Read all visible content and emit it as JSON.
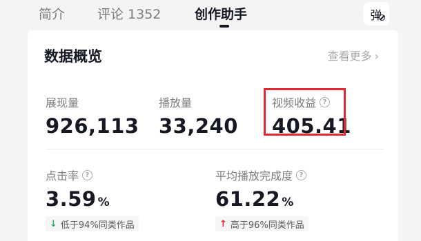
{
  "tabs": {
    "intro": "简介",
    "comments": "评论 1352",
    "assistant": "创作助手"
  },
  "danmaku_button": {
    "glyph": "弹",
    "icon": "danmaku-off-icon"
  },
  "card": {
    "title": "数据概览",
    "see_more": "查看更多",
    "see_more_icon": "chevron-right-icon"
  },
  "metrics": {
    "exposure": {
      "label": "展现量",
      "value": "926,113"
    },
    "plays": {
      "label": "播放量",
      "value": "33,240"
    },
    "revenue": {
      "label": "视频收益",
      "value": "405.41",
      "info_icon": "?"
    },
    "ctr": {
      "label": "点击率",
      "value": "3.59",
      "unit": "%",
      "info_icon": "?",
      "compare_text": "低于94%同类作品",
      "compare_direction": "down"
    },
    "completion": {
      "label": "平均播放完成度",
      "value": "61.22",
      "unit": "%",
      "info_icon": "?",
      "compare_text": "高于96%同类作品",
      "compare_direction": "up"
    }
  },
  "colors": {
    "highlight_border": "#e3262f",
    "arrow_down": "#2db36a",
    "arrow_up": "#e3262f"
  }
}
